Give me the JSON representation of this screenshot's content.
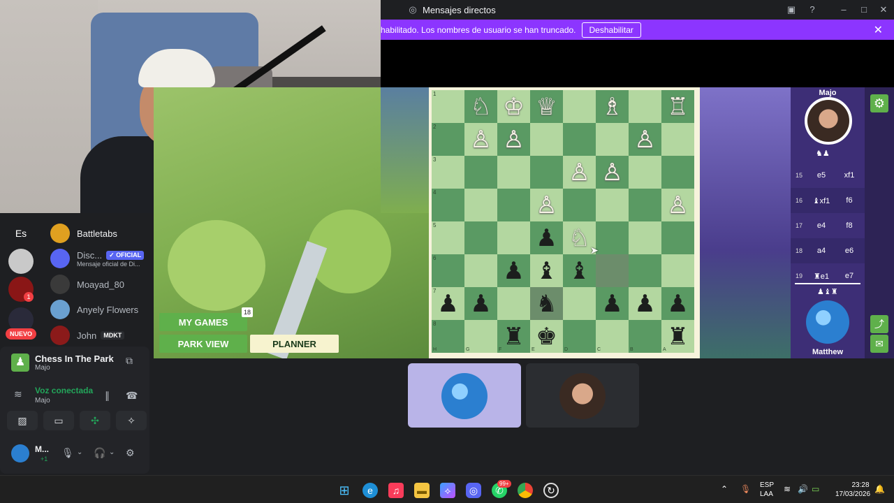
{
  "window": {
    "title": "Mensajes directos"
  },
  "banner": {
    "text": "habilitado. Los nombres de usuario se han truncado.",
    "button": "Deshabilitar"
  },
  "game": {
    "menu": {
      "my_games": "MY GAMES",
      "my_games_count": "18",
      "park_view": "PARK VIEW",
      "planner": "PLANNER"
    },
    "players": {
      "top": "Majo",
      "bottom": "Matthew"
    },
    "board": {
      "ranks": [
        "1",
        "2",
        "3",
        "4",
        "5",
        "6",
        "7",
        "8"
      ],
      "files": [
        "H",
        "G",
        "F",
        "E",
        "D",
        "C",
        "B",
        "A"
      ],
      "rows": [
        [
          "",
          "wN",
          "wK",
          "wQ",
          "",
          "wB",
          "",
          "wR"
        ],
        [
          "",
          "wP",
          "wP",
          "",
          "",
          "",
          "wP",
          ""
        ],
        [
          "",
          "",
          "",
          "",
          "wP",
          "wP",
          "",
          ""
        ],
        [
          "",
          "",
          "",
          "wP",
          "",
          "",
          "",
          "wP"
        ],
        [
          "",
          "",
          "",
          "bP",
          "wN",
          "",
          "",
          ""
        ],
        [
          "",
          "",
          "bP",
          "bB",
          "bB",
          "",
          "",
          ""
        ],
        [
          "bP",
          "bP",
          "",
          "bN",
          "",
          "bP",
          "bP",
          "bP"
        ],
        [
          "",
          "",
          "bR",
          "bK",
          "",
          "",
          "",
          "bR"
        ]
      ],
      "highlighted": [
        [
          5,
          5
        ],
        [
          6,
          3
        ]
      ]
    },
    "moves": [
      {
        "n": "15",
        "w": "e5",
        "b": "xf1"
      },
      {
        "n": "16",
        "w": "♝xf1",
        "b": "f6"
      },
      {
        "n": "17",
        "w": "e4",
        "b": "f8"
      },
      {
        "n": "18",
        "w": "a4",
        "b": "e6"
      },
      {
        "n": "19",
        "w": "♜e1",
        "b": "e7"
      }
    ]
  },
  "sidebar": {
    "guild_label": "Es",
    "new_badge": "NUEVO",
    "notification_count": "1",
    "dms": [
      {
        "name": "Battletabs",
        "color": "#e0a020"
      },
      {
        "name": "Disc...",
        "sub": "Mensaje oficial de Di...",
        "badge": "✓ OFICIAL",
        "color": "#5865f2"
      },
      {
        "name": "Moayad_80",
        "color": "#3a3a3a"
      },
      {
        "name": "Anyely Flowers",
        "color": "#6aa0d0"
      },
      {
        "name": "John",
        "badge": "MDKT",
        "color": "#8b1a1a"
      }
    ]
  },
  "activity": {
    "app_name": "Chess In The Park",
    "app_sub": "Majo",
    "voice_status": "Voz conectada",
    "voice_sub": "Majo",
    "user_name": "M...",
    "user_sub": "+1"
  },
  "taskbar": {
    "lang_top": "ESP",
    "lang_bottom": "LAA",
    "time": "23:28",
    "date": "17/03/2026",
    "whatsapp_badge": "99+"
  }
}
